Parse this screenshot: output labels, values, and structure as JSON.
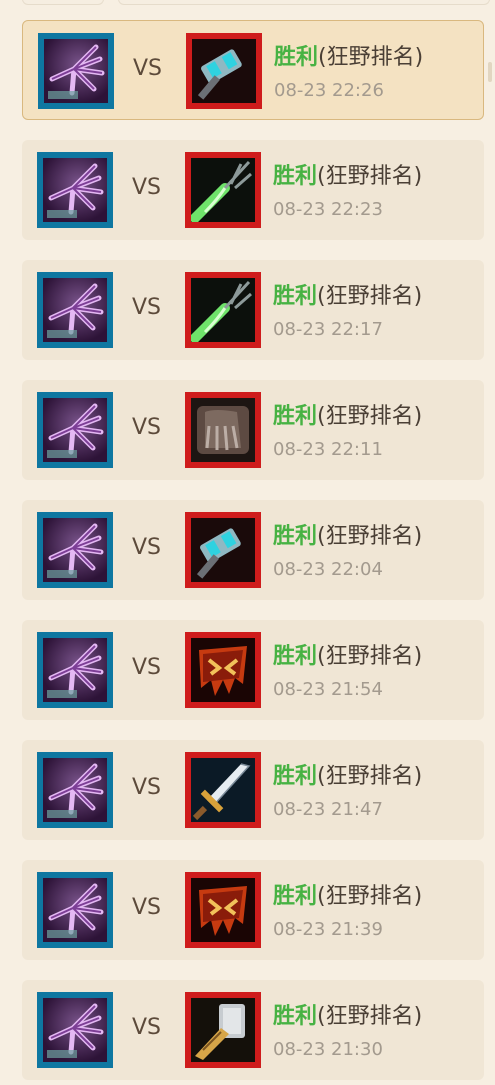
{
  "vs_label": "VS",
  "matches": [
    {
      "result": "胜利",
      "mode": "(狂野排名)",
      "time": "08-23 22:26",
      "selected": true,
      "own_icon": "purple-claw-icon",
      "enemy_icon": "frost-hammer-icon"
    },
    {
      "result": "胜利",
      "mode": "(狂野排名)",
      "time": "08-23 22:23",
      "selected": false,
      "own_icon": "purple-claw-icon",
      "enemy_icon": "green-arrow-icon"
    },
    {
      "result": "胜利",
      "mode": "(狂野排名)",
      "time": "08-23 22:17",
      "selected": false,
      "own_icon": "purple-claw-icon",
      "enemy_icon": "green-arrow-icon"
    },
    {
      "result": "胜利",
      "mode": "(狂野排名)",
      "time": "08-23 22:11",
      "selected": false,
      "own_icon": "purple-claw-icon",
      "enemy_icon": "stone-claw-icon"
    },
    {
      "result": "胜利",
      "mode": "(狂野排名)",
      "time": "08-23 22:04",
      "selected": false,
      "own_icon": "purple-claw-icon",
      "enemy_icon": "frost-hammer-icon"
    },
    {
      "result": "胜利",
      "mode": "(狂野排名)",
      "time": "08-23 21:54",
      "selected": false,
      "own_icon": "purple-claw-icon",
      "enemy_icon": "demon-banner-icon"
    },
    {
      "result": "胜利",
      "mode": "(狂野排名)",
      "time": "08-23 21:47",
      "selected": false,
      "own_icon": "purple-claw-icon",
      "enemy_icon": "sword-icon"
    },
    {
      "result": "胜利",
      "mode": "(狂野排名)",
      "time": "08-23 21:39",
      "selected": false,
      "own_icon": "purple-claw-icon",
      "enemy_icon": "demon-banner-icon"
    },
    {
      "result": "胜利",
      "mode": "(狂野排名)",
      "time": "08-23 21:30",
      "selected": false,
      "own_icon": "purple-claw-icon",
      "enemy_icon": "golden-hammer-icon"
    }
  ],
  "colors": {
    "win": "#47b243",
    "own_frame": "#0e77a1",
    "enemy_frame": "#cf1c1c",
    "selected_bg": "#f4e2c2",
    "row_bg": "#f0e6d5"
  }
}
